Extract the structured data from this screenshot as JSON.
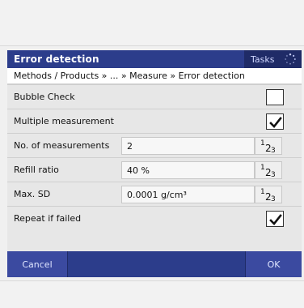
{
  "header": {
    "title": "Error detection",
    "tasks_label": "Tasks"
  },
  "breadcrumb": {
    "text": "Methods / Products » ... » Measure » Error detection"
  },
  "settings": [
    {
      "label": "Bubble Check",
      "type": "checkbox",
      "checked": false
    },
    {
      "label": "Multiple measurement",
      "type": "checkbox",
      "checked": true
    },
    {
      "label": "No. of measurements",
      "type": "numeric",
      "value": "2"
    },
    {
      "label": "Refill ratio",
      "type": "numeric",
      "value": "40 %"
    },
    {
      "label": "Max. SD",
      "type": "numeric",
      "value": "0.0001 g/cm³"
    },
    {
      "label": "Repeat if failed",
      "type": "checkbox",
      "checked": true
    }
  ],
  "footer": {
    "cancel_label": "Cancel",
    "ok_label": "OK"
  },
  "icons": {
    "numpad_icon": {
      "name": "numeric-keypad-icon",
      "glyphs": [
        "1",
        "2",
        "3"
      ]
    },
    "tasks_icon": "busy-spinner-icon",
    "checkmark_icon": "checkmark-icon"
  },
  "colors": {
    "accent_blue": "#2c3d8b",
    "button_blue": "#3b4aa0",
    "panel_gray": "#e7e7e7"
  }
}
